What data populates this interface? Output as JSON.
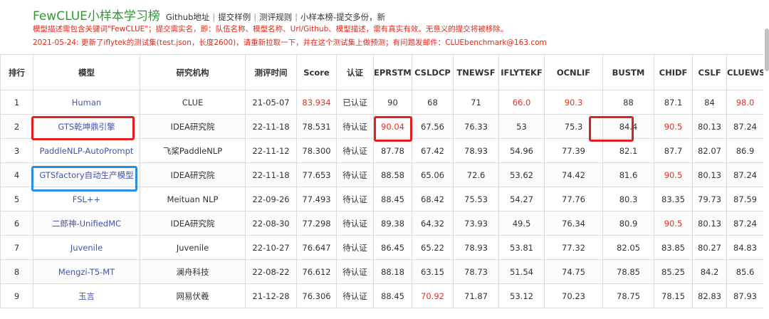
{
  "header": {
    "title": "FewCLUE小样本学习榜",
    "links": [
      "Github地址",
      "提交样例",
      "测评规则",
      "小样本榜-提交多份，新"
    ],
    "separator": "|",
    "notice1": "模型描述需包含关键词\"FewCLUE\"；提交需实名，即：队伍名称、模型名称、Url/Github、模型描述，需有真实有效。无意义的提交将被移除。",
    "notice2": "2021-05-24: 更新了iflytek的测试集(test.json，长度2600)，请重新拉取一下，并在这个测试集上做预测；有问题发邮件：CLUEbenchmark@163.com"
  },
  "colors": {
    "title": "#2c9a2c",
    "notice": "#e0281b",
    "model_link": "#4455aa",
    "highlight_value": "#e53124",
    "red_box": "#e02020",
    "blue_box": "#2b8fe0"
  },
  "table": {
    "columns": [
      "排行",
      "模型",
      "研究机构",
      "测评时间",
      "Score",
      "认证",
      "EPRSTMT",
      "CSLDCP",
      "TNEWSF",
      "IFLYTEKF",
      "OCNLIF",
      "BUSTM",
      "CHIDF",
      "CSLF",
      "CLUEWSCF"
    ],
    "rows": [
      {
        "rank": "1",
        "model": "Human",
        "org": "CLUE",
        "date": "21-05-07",
        "score": "83.934",
        "cert": "已认证",
        "eprstmt": "90",
        "csldcp": "68",
        "tnewsf": "71",
        "iflytekf": "66.0",
        "ocnlif": "90.3",
        "bustm": "88",
        "chidf": "87.1",
        "cslf": "84",
        "cluewscf": "98.0"
      },
      {
        "rank": "2",
        "model": "GTS乾坤鼎引擎",
        "org": "IDEA研究院",
        "date": "22-11-18",
        "score": "78.531",
        "cert": "待认证",
        "eprstmt": "90.04",
        "csldcp": "67.56",
        "tnewsf": "76.33",
        "iflytekf": "53",
        "ocnlif": "75.3",
        "bustm": "84.4",
        "chidf": "90.5",
        "cslf": "80.13",
        "cluewscf": "87.24"
      },
      {
        "rank": "3",
        "model": "PaddleNLP-AutoPrompt",
        "org": "飞桨PaddleNLP",
        "date": "22-11-12",
        "score": "78.300",
        "cert": "待认证",
        "eprstmt": "87.78",
        "csldcp": "67.42",
        "tnewsf": "78.93",
        "iflytekf": "54.96",
        "ocnlif": "77.39",
        "bustm": "82.1",
        "chidf": "87.7",
        "cslf": "82.07",
        "cluewscf": "86.9"
      },
      {
        "rank": "4",
        "model": "GTSfactory自动生产模型",
        "org": "IDEA研究院",
        "date": "22-11-18",
        "score": "77.653",
        "cert": "待认证",
        "eprstmt": "88.58",
        "csldcp": "65.06",
        "tnewsf": "72.6",
        "iflytekf": "53.62",
        "ocnlif": "74.42",
        "bustm": "81.6",
        "chidf": "90.5",
        "cslf": "80.13",
        "cluewscf": "87.24"
      },
      {
        "rank": "5",
        "model": "FSL++",
        "org": "Meituan NLP",
        "date": "22-09-26",
        "score": "77.493",
        "cert": "待认证",
        "eprstmt": "88.45",
        "csldcp": "68.42",
        "tnewsf": "75.53",
        "iflytekf": "54.27",
        "ocnlif": "77.76",
        "bustm": "80.3",
        "chidf": "83.35",
        "cslf": "79.73",
        "cluewscf": "87.59"
      },
      {
        "rank": "6",
        "model": "二郎神-UnifiedMC",
        "org": "IDEA研究院",
        "date": "22-08-30",
        "score": "77.298",
        "cert": "待认证",
        "eprstmt": "89.38",
        "csldcp": "64.32",
        "tnewsf": "73.93",
        "iflytekf": "49.5",
        "ocnlif": "76.34",
        "bustm": "80.9",
        "chidf": "90.5",
        "cslf": "80.13",
        "cluewscf": "87.24"
      },
      {
        "rank": "7",
        "model": "Juvenile",
        "org": "Juvenile",
        "date": "22-10-27",
        "score": "76.647",
        "cert": "待认证",
        "eprstmt": "86.45",
        "csldcp": "65.22",
        "tnewsf": "78.93",
        "iflytekf": "53.81",
        "ocnlif": "77.32",
        "bustm": "82.05",
        "chidf": "83.85",
        "cslf": "80.27",
        "cluewscf": "84.83"
      },
      {
        "rank": "8",
        "model": "Mengzi-T5-MT",
        "org": "澜舟科技",
        "date": "22-08-22",
        "score": "76.612",
        "cert": "待认证",
        "eprstmt": "88.18",
        "csldcp": "63.15",
        "tnewsf": "78.73",
        "iflytekf": "51.54",
        "ocnlif": "74.75",
        "bustm": "78.85",
        "chidf": "85.25",
        "cslf": "84.2",
        "cluewscf": "85.6"
      },
      {
        "rank": "9",
        "model": "玉言",
        "org": "网易伏羲",
        "date": "21-12-28",
        "score": "76.306",
        "cert": "待认证",
        "eprstmt": "88.45",
        "csldcp": "70.92",
        "tnewsf": "71.87",
        "iflytekf": "53.12",
        "ocnlif": "70.23",
        "bustm": "78.75",
        "chidf": "78.15",
        "cslf": "82.83",
        "cluewscf": "87.93"
      }
    ],
    "red_cells": {
      "1": [
        "score",
        "iflytekf",
        "ocnlif",
        "cluewscf"
      ],
      "2": [
        "eprstmt",
        "chidf"
      ],
      "4": [
        "chidf"
      ],
      "6": [
        "chidf"
      ],
      "9": [
        "csldcp"
      ]
    }
  }
}
